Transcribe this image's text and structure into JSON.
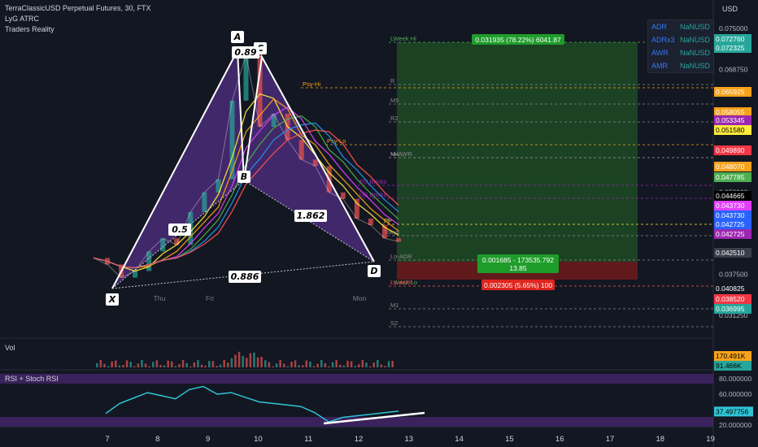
{
  "header": {
    "symbol_line": "TerraClassicUSD Perpetual Futures, 30, FTX",
    "indicator_1": "LyG ATRC",
    "indicator_2": "Traders Reality"
  },
  "currency_label": "USD",
  "price_scale": {
    "ticks": [
      "0.075000",
      "0.068750",
      "0.062500",
      "0.056250",
      "0.050000",
      "0.043750",
      "0.037500",
      "0.031250"
    ],
    "badges": [
      {
        "text": "0.072760",
        "color": "#26a69a"
      },
      {
        "text": "0.072325",
        "color": "#26a69a"
      },
      {
        "text": "0.065925",
        "color": "#f7a21b"
      },
      {
        "text": "0.058055",
        "color": "#f7a21b"
      },
      {
        "text": "0.053345",
        "color": "#9c27b0"
      },
      {
        "text": "0.051580",
        "color": "#ffeb3b"
      },
      {
        "text": "0.049890",
        "color": "#f23645"
      },
      {
        "text": "0.048070",
        "color": "#f7a21b"
      },
      {
        "text": "0.047785",
        "color": "#4caf50"
      },
      {
        "text": "0.044665",
        "color": "#000000"
      },
      {
        "text": "0.043730",
        "color": "#e040fb"
      },
      {
        "text": "0.043730",
        "color": "#2962ff"
      },
      {
        "text": "0.042725",
        "color": "#2962ff"
      },
      {
        "text": "0.042725",
        "color": "#9c27b0"
      },
      {
        "text": "0.042510",
        "color": "#3a3e4a"
      },
      {
        "text": "0.040825",
        "color": "#131722"
      },
      {
        "text": "0.038520",
        "color": "#f23645"
      },
      {
        "text": "0.036995",
        "color": "#26a69a"
      }
    ],
    "vol_badges": [
      "170.491K",
      "91.466K"
    ],
    "rsi_badges": [
      "37.497756"
    ],
    "rsi_ticks": [
      "80.000000",
      "60.000000",
      "40.000000",
      "20.000000"
    ]
  },
  "adr_table": [
    {
      "label": "ADR",
      "value": "NaNUSD"
    },
    {
      "label": "ADRx3",
      "value": "NaNUSD"
    },
    {
      "label": "AWR",
      "value": "NaNUSD"
    },
    {
      "label": "AMR",
      "value": "NaNUSD"
    }
  ],
  "pattern": {
    "points": [
      "X",
      "A",
      "B",
      "C",
      "D"
    ],
    "ratios": [
      "0.89",
      "0.5",
      "1.862",
      "0.886"
    ]
  },
  "position": {
    "profit_label": "0.031935 (78.22%) 6041.87",
    "entry_label_1": "0.001685 - 173535.792",
    "entry_label_2": "13.85",
    "loss_label": "0.002305 (5.65%) 100"
  },
  "level_labels": [
    "LWeek Hi",
    "R",
    "M5",
    "R2",
    "Psy-Hi",
    "Psy-Lo",
    "M4",
    "Hi-AWR",
    "EU Brinks",
    "US Brinks",
    "PP",
    "Tokyo",
    "Lo-ADR",
    "LWeek Lo",
    "Lo-AMR",
    "M1",
    "S2"
  ],
  "x_axis": {
    "main": [
      "Thu",
      "Fri",
      "Mon"
    ],
    "bottom": [
      "7",
      "8",
      "9",
      "10",
      "11",
      "12",
      "13",
      "14",
      "15",
      "16",
      "17",
      "18",
      "19"
    ]
  },
  "panes": {
    "volume": "Vol",
    "rsi": "RSI + Stoch RSI"
  },
  "chart_data": {
    "type": "line",
    "title": "TerraClassicUSD Perpetual Futures, 30, FTX",
    "ylim": [
      0.028,
      0.078
    ],
    "harmonic_pattern": [
      {
        "point": "X",
        "day": 7.2,
        "price": 0.0358
      },
      {
        "point": "A",
        "day": 9.65,
        "price": 0.0745
      },
      {
        "point": "B",
        "day": 9.8,
        "price": 0.0455
      },
      {
        "point": "C",
        "day": 10.1,
        "price": 0.0735
      },
      {
        "point": "D",
        "day": 12.4,
        "price": 0.0415
      }
    ],
    "position_tool": {
      "target": 0.07276,
      "entry": 0.04172,
      "stop": 0.0394
    },
    "price": [
      0.04,
      0.039,
      0.037,
      0.038,
      0.041,
      0.043,
      0.042,
      0.047,
      0.05,
      0.052,
      0.064,
      0.071,
      0.06,
      0.062,
      0.058,
      0.055,
      0.054,
      0.05,
      0.049,
      0.046,
      0.045,
      0.043,
      0.0425
    ],
    "rsi": [
      35,
      48,
      55,
      62,
      58,
      54,
      66,
      70,
      60,
      62,
      56,
      50,
      48,
      46,
      44,
      36,
      24,
      30,
      32,
      34,
      36,
      38
    ]
  }
}
